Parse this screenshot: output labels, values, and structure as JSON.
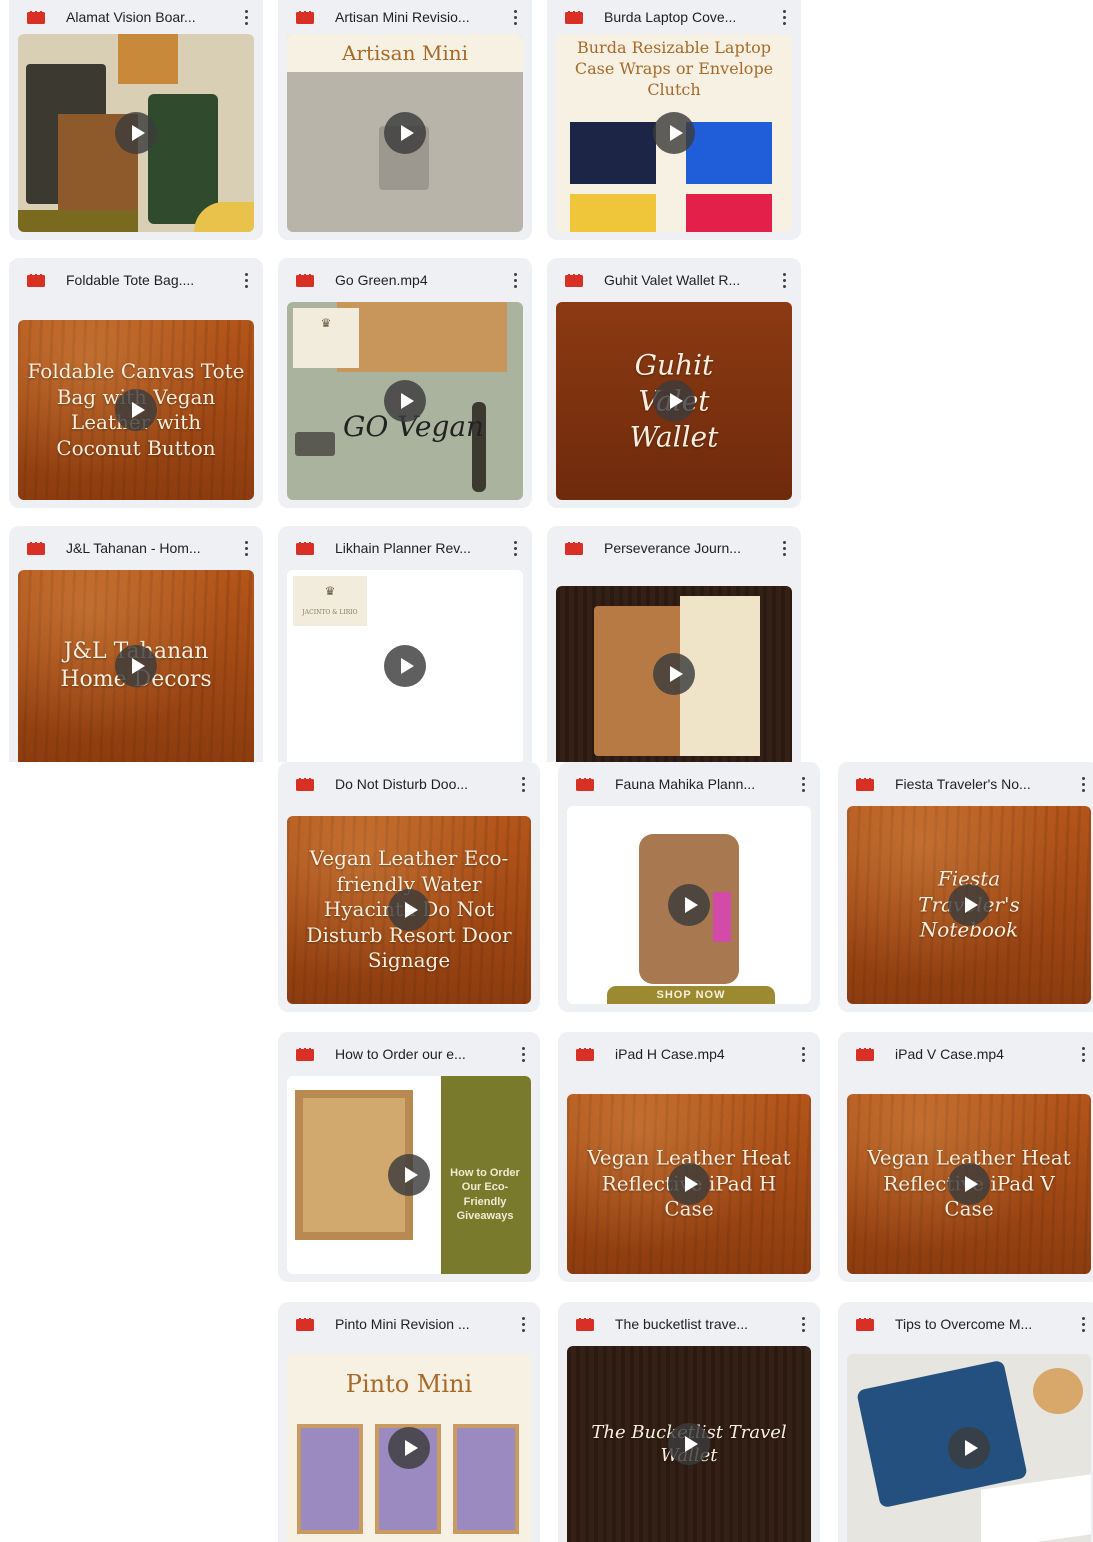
{
  "play_label": "Play",
  "top_files": [
    {
      "title": "Alamat Vision Boar...",
      "thumb": "collage"
    },
    {
      "title": "Artisan Mini Revisio...",
      "thumb": "artisan",
      "banner": "Artisan Mini"
    },
    {
      "title": "Burda Laptop Cove...",
      "thumb": "burda",
      "banner": "Burda Resizable Laptop Case Wraps or Envelope Clutch"
    },
    {
      "title": "Foldable Tote Bag....",
      "thumb": "wood",
      "text": "Foldable Canvas Tote Bag with Vegan Leather with Coconut Button"
    },
    {
      "title": "Go Green.mp4",
      "thumb": "gogreen",
      "text": "GO Vegan"
    },
    {
      "title": "Guhit Valet Wallet R...",
      "thumb": "wood-script",
      "text": "Guhit Valet Wallet"
    },
    {
      "title": "J&L Tahanan - Hom...",
      "thumb": "wood",
      "text": "J&L Tahanan Home Decors"
    },
    {
      "title": "Likhain Planner Rev...",
      "thumb": "blank",
      "logo": "JACINTO & LIRIO"
    },
    {
      "title": "Perseverance Journ...",
      "thumb": "journal"
    }
  ],
  "bottom_files": [
    {
      "title": "Do Not Disturb Doo...",
      "thumb": "wood",
      "text": "Vegan Leather Eco-friendly Water Hyacinth Do Not Disturb Resort Door Signage"
    },
    {
      "title": "Fauna Mahika Plann...",
      "thumb": "fauna",
      "button": "SHOP NOW"
    },
    {
      "title": "Fiesta Traveler's No...",
      "thumb": "wood-script",
      "text": "Fiesta Traveler's Notebook"
    },
    {
      "title": "How to Order our e...",
      "thumb": "howto",
      "text": "How to Order Our Eco-Friendly Giveaways"
    },
    {
      "title": "iPad H Case.mp4",
      "thumb": "wood",
      "text": "Vegan Leather Heat Reflective iPad H Case"
    },
    {
      "title": "iPad V Case.mp4",
      "thumb": "wood",
      "text": "Vegan Leather Heat Reflective iPad V Case"
    },
    {
      "title": "Pinto Mini Revision ...",
      "thumb": "pinto",
      "banner": "Pinto Mini"
    },
    {
      "title": "The bucketlist trave...",
      "thumb": "darkwood",
      "text": "The Bucketlist Travel Wallet"
    },
    {
      "title": "Tips to Overcome M...",
      "thumb": "tips"
    }
  ],
  "colors": {
    "video_icon": "#d93025",
    "card_bg": "#eef0f4",
    "title_text": "#1f1f1f"
  }
}
